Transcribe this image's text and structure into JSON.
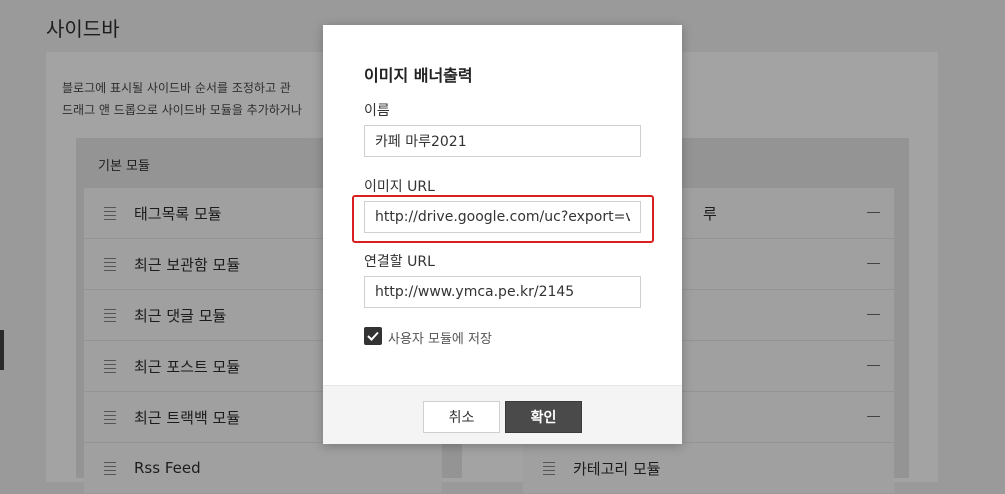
{
  "page": {
    "title": "사이드바",
    "description_line1": "블로그에 표시될 사이드바 순서를 조정하고 관",
    "description_line2": "드래그 앤 드롭으로 사이드바 모듈을 추가하거나"
  },
  "left_panel": {
    "header": "기본 모듈",
    "items": [
      {
        "label": "태그목록 모듈"
      },
      {
        "label": "최근 보관함 모듈"
      },
      {
        "label": "최근 댓글 모듈"
      },
      {
        "label": "최근 포스트 모듈"
      },
      {
        "label": "최근 트랙백 모듈"
      },
      {
        "label": "Rss Feed"
      }
    ]
  },
  "right_panel": {
    "items": [
      {
        "label": "루"
      },
      {
        "label": ""
      },
      {
        "label": ""
      },
      {
        "label": ""
      },
      {
        "label": ""
      },
      {
        "label": "카테고리 모듈"
      }
    ]
  },
  "modal": {
    "title": "이미지 배너출력",
    "name_label": "이름",
    "name_value": "카페 마루2021",
    "image_url_label": "이미지 URL",
    "image_url_value": "http://drive.google.com/uc?export=view&",
    "link_url_label": "연결할 URL",
    "link_url_value": "http://www.ymca.pe.kr/2145",
    "checkbox_label": "사용자 모듈에 저장",
    "checkbox_checked": true,
    "cancel_label": "취소",
    "ok_label": "확인"
  },
  "colors": {
    "highlight": "#d9201f",
    "primary_button": "#4a4a4a"
  }
}
